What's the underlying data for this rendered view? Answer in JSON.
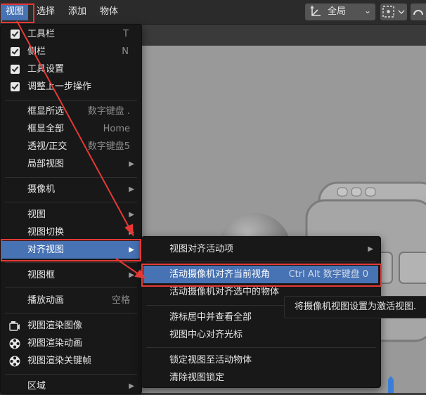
{
  "header": {
    "menus": [
      "视图",
      "选择",
      "添加",
      "物体"
    ],
    "transform_orientation": "全局"
  },
  "view_menu": {
    "items": [
      {
        "label": "工具栏",
        "shortcut": "T",
        "check": true
      },
      {
        "label": "侧栏",
        "shortcut": "N",
        "check": true
      },
      {
        "label": "工具设置",
        "shortcut": "",
        "check": true
      },
      {
        "label": "调整上一步操作",
        "shortcut": "",
        "check": true
      },
      {
        "label": "框显所选",
        "shortcut": "数字键盘 ."
      },
      {
        "label": "框显全部",
        "shortcut": "Home"
      },
      {
        "label": "透视/正交",
        "shortcut": "数字键盘5"
      },
      {
        "label": "局部视图",
        "shortcut": "",
        "submenu": true
      },
      {
        "label": "摄像机",
        "shortcut": "",
        "submenu": true
      },
      {
        "label": "视图",
        "shortcut": "",
        "submenu": true
      },
      {
        "label": "视图切换",
        "shortcut": "",
        "submenu": true
      },
      {
        "label": "对齐视图",
        "shortcut": "",
        "submenu": true
      },
      {
        "label": "视图框",
        "shortcut": "",
        "submenu": true
      },
      {
        "label": "播放动画",
        "shortcut": "空格"
      },
      {
        "label": "视图渲染图像",
        "icon": "render-image-icon"
      },
      {
        "label": "视图渲染动画",
        "icon": "film-reel-icon"
      },
      {
        "label": "视图渲染关键帧",
        "icon": "film-reel-icon"
      },
      {
        "label": "区域",
        "shortcut": "",
        "submenu": true
      }
    ]
  },
  "align_menu": {
    "items": [
      {
        "label": "视图对齐活动项",
        "shortcut": "",
        "submenu": true
      },
      {
        "label": "活动摄像机对齐当前视角",
        "shortcut": "Ctrl Alt 数字键盘 0"
      },
      {
        "label": "活动摄像机对齐选中的物体",
        "shortcut": ""
      },
      {
        "label": "游标居中并查看全部",
        "shortcut": ""
      },
      {
        "label": "视图中心对齐光标",
        "shortcut": ""
      },
      {
        "label": "锁定视图至活动物体",
        "shortcut": ""
      },
      {
        "label": "清除视图锁定",
        "shortcut": ""
      }
    ]
  },
  "tooltip": "将摄像机视图设置为激活视图.",
  "colors": {
    "highlight": "#4772b3",
    "annotation": "#e53935"
  }
}
